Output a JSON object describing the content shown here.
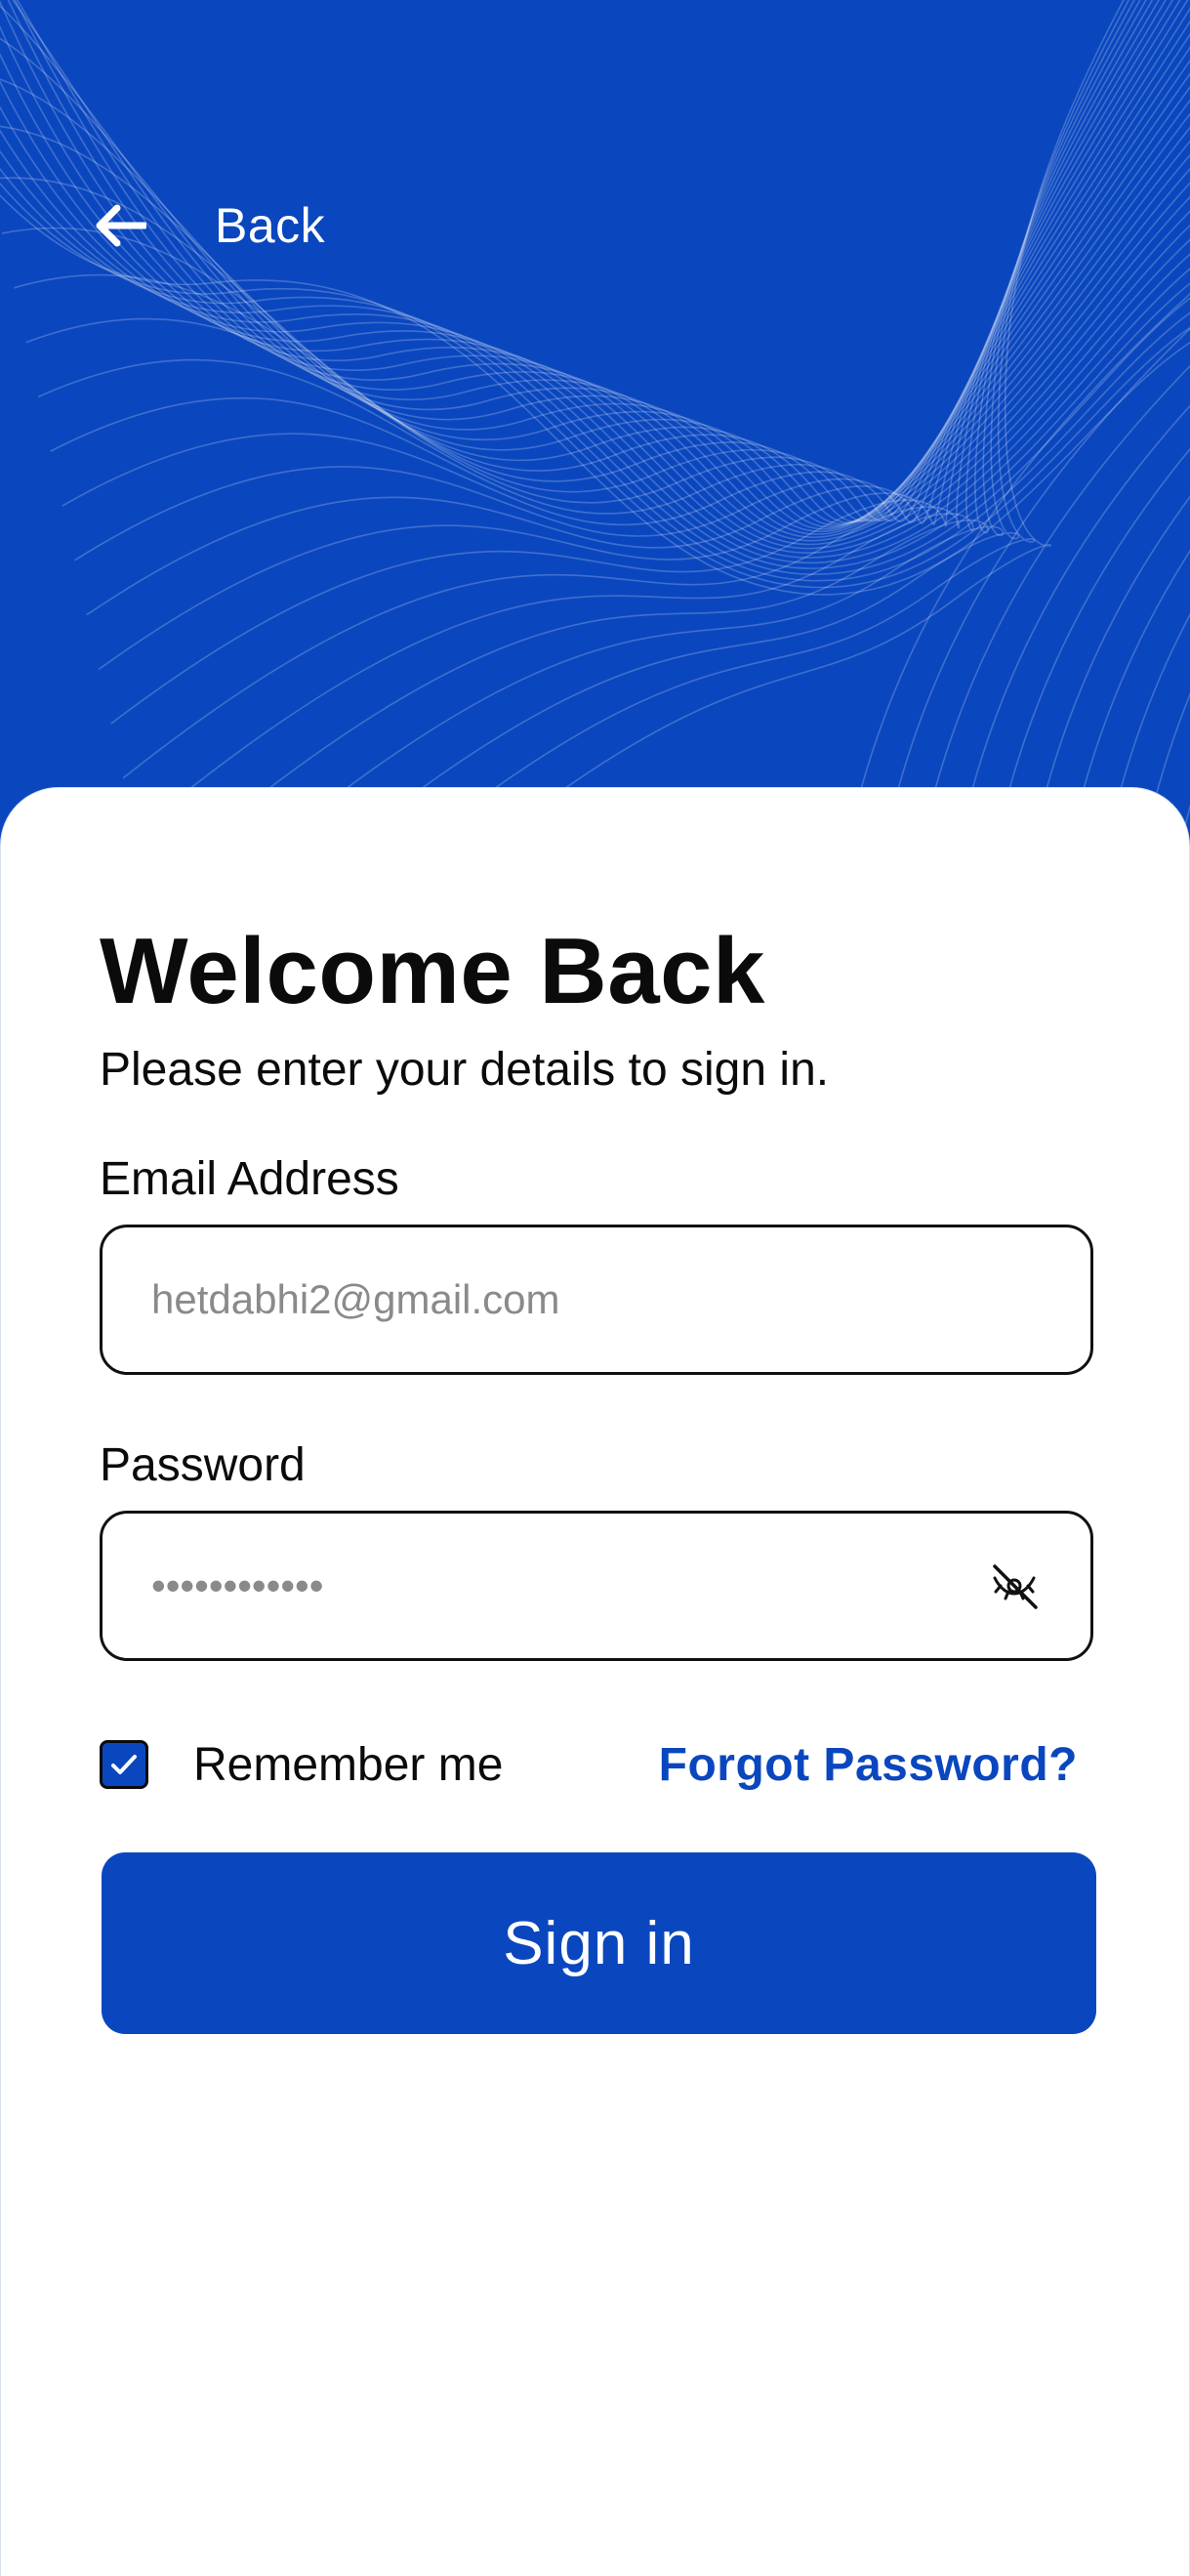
{
  "header": {
    "back_label": "Back",
    "back_icon": "arrow-left-icon"
  },
  "form": {
    "title": "Welcome Back",
    "subtitle": "Please enter your details to sign in.",
    "email": {
      "label": "Email Address",
      "placeholder": "hetdabhi2@gmail.com",
      "value": ""
    },
    "password": {
      "label": "Password",
      "masked_value": "••••••••••••",
      "toggle_icon": "eye-off-icon"
    },
    "remember": {
      "label": "Remember me",
      "checked": true
    },
    "forgot_label": "Forgot Password?",
    "submit_label": "Sign in"
  },
  "colors": {
    "brand": "#0a47bf",
    "text": "#0b0b0b",
    "placeholder": "#8a8a8a",
    "surface": "#ffffff"
  }
}
